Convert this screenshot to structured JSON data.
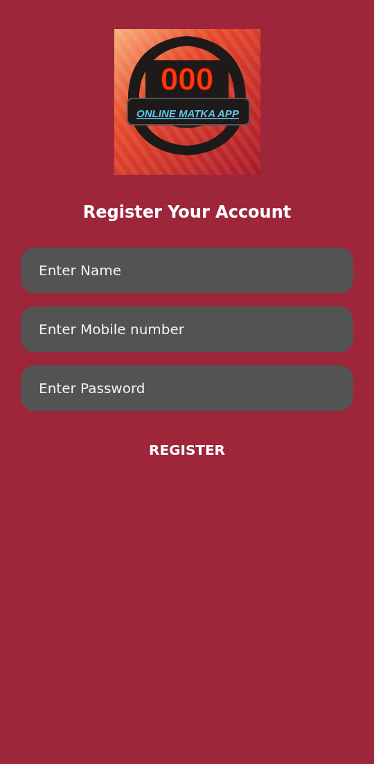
{
  "logo": {
    "number": "000",
    "title": "ONLINE MATKA APP"
  },
  "title": "Register Your Account",
  "fields": [
    {
      "placeholder": "Enter Name"
    },
    {
      "placeholder": "Enter Mobile number"
    },
    {
      "placeholder": "Enter Password"
    }
  ],
  "button": "REGISTER"
}
